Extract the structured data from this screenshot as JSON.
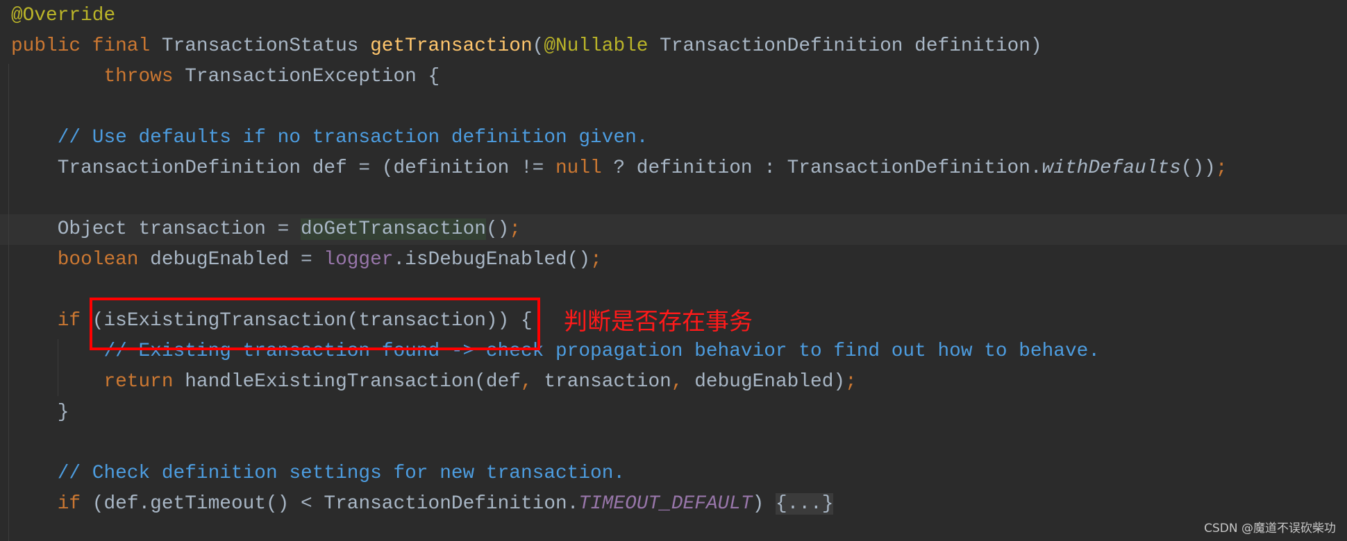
{
  "colors": {
    "background": "#2b2b2b",
    "keyword": "#cc7832",
    "annotation": "#bbb529",
    "method_declaration": "#ffc66d",
    "comment": "#4d9de0",
    "text": "#a9b7c6",
    "field": "#9876aa",
    "annotation_box": "#ff0000"
  },
  "code_lines": [
    [
      {
        "t": "@Override",
        "c": "ann"
      }
    ],
    [
      {
        "t": "public final ",
        "c": "kw"
      },
      {
        "t": "TransactionStatus ",
        "c": "txt"
      },
      {
        "t": "getTransaction",
        "c": "decl"
      },
      {
        "t": "(",
        "c": "txt"
      },
      {
        "t": "@Nullable ",
        "c": "ann"
      },
      {
        "t": "TransactionDefinition definition)",
        "c": "txt"
      }
    ],
    [
      {
        "t": "        throws ",
        "c": "kw"
      },
      {
        "t": "TransactionException {",
        "c": "txt"
      }
    ],
    [],
    [
      {
        "t": "    // Use defaults if no transaction definition given.",
        "c": "cm"
      }
    ],
    [
      {
        "t": "    TransactionDefinition def = (definition != ",
        "c": "txt"
      },
      {
        "t": "null ",
        "c": "kw"
      },
      {
        "t": "? definition : TransactionDefinition.",
        "c": "txt"
      },
      {
        "t": "withDefaults",
        "c": "txt it"
      },
      {
        "t": "())",
        "c": "txt"
      },
      {
        "t": ";",
        "c": "kw"
      }
    ],
    [],
    [
      {
        "t": "    Object transaction = ",
        "c": "txt"
      },
      {
        "t": "doGetTransaction",
        "c": "txt hl"
      },
      {
        "t": "()",
        "c": "txt"
      },
      {
        "t": ";",
        "c": "kw"
      }
    ],
    [
      {
        "t": "    boolean ",
        "c": "kw"
      },
      {
        "t": "debugEnabled = ",
        "c": "txt"
      },
      {
        "t": "logger",
        "c": "field"
      },
      {
        "t": ".isDebugEnabled()",
        "c": "txt"
      },
      {
        "t": ";",
        "c": "kw"
      }
    ],
    [],
    [
      {
        "t": "    if ",
        "c": "kw"
      },
      {
        "t": "(isExistingTransaction(transaction)) {",
        "c": "txt"
      }
    ],
    [
      {
        "t": "        // Existing transaction found -> check propagation behavior to find out how to behave.",
        "c": "cm"
      }
    ],
    [
      {
        "t": "        return ",
        "c": "kw"
      },
      {
        "t": "handleExistingTransaction(def",
        "c": "txt"
      },
      {
        "t": ", ",
        "c": "kw"
      },
      {
        "t": "transaction",
        "c": "txt"
      },
      {
        "t": ", ",
        "c": "kw"
      },
      {
        "t": "debugEnabled)",
        "c": "txt"
      },
      {
        "t": ";",
        "c": "kw"
      }
    ],
    [
      {
        "t": "    }",
        "c": "txt"
      }
    ],
    [],
    [
      {
        "t": "    // Check definition settings for new transaction.",
        "c": "cm"
      }
    ],
    [
      {
        "t": "    if ",
        "c": "kw"
      },
      {
        "t": "(def.getTimeout() < TransactionDefinition.",
        "c": "txt"
      },
      {
        "t": "TIMEOUT_DEFAULT",
        "c": "field it"
      },
      {
        "t": ") ",
        "c": "txt"
      },
      {
        "t": "{...}",
        "c": "fold"
      }
    ]
  ],
  "current_line": 7,
  "annotation_note": "判断是否存在事务",
  "watermark": "CSDN @魔道不误砍柴功"
}
